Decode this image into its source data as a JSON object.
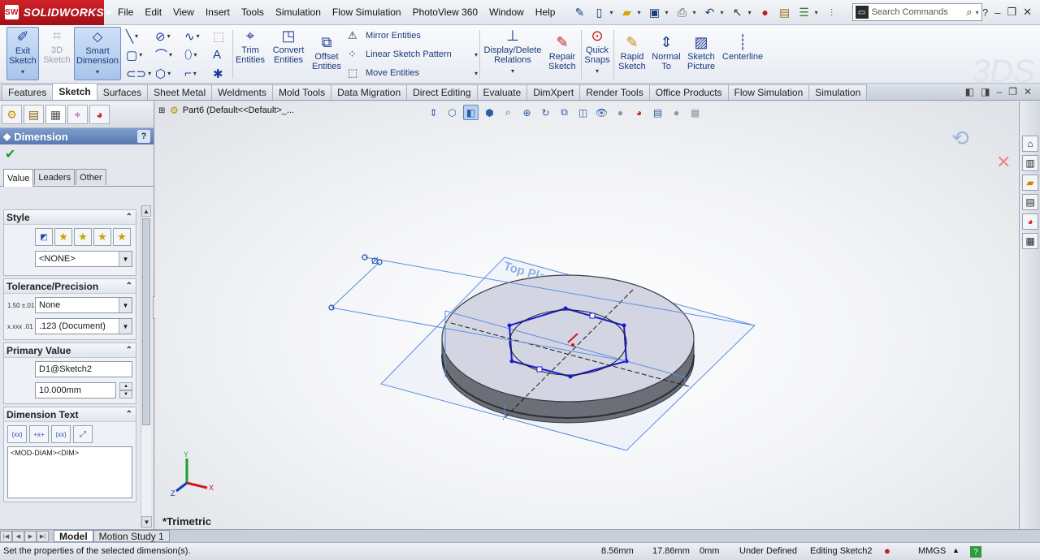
{
  "app": {
    "logo_text": "SOLIDWORKS",
    "logo_badge": "SW"
  },
  "menu": [
    "File",
    "Edit",
    "View",
    "Insert",
    "Tools",
    "Simulation",
    "Flow Simulation",
    "PhotoView 360",
    "Window",
    "Help"
  ],
  "search": {
    "placeholder": "Search Commands"
  },
  "toolbar": {
    "exit_sketch": "Exit Sketch",
    "sketch_3d": "3D Sketch",
    "smart_dimension": "Smart Dimension",
    "trim_entities": "Trim Entities",
    "convert_entities": "Convert Entities",
    "offset_entities": "Offset Entities",
    "mirror_entities": "Mirror Entities",
    "linear_sketch_pattern": "Linear Sketch Pattern",
    "move_entities": "Move Entities",
    "display_delete_relations": "Display/Delete Relations",
    "repair_sketch": "Repair Sketch",
    "quick_snaps": "Quick Snaps",
    "rapid_sketch": "Rapid Sketch",
    "normal_to": "Normal To",
    "sketch_picture": "Sketch Picture",
    "centerline": "Centerline"
  },
  "command_tabs": [
    "Features",
    "Sketch",
    "Surfaces",
    "Sheet Metal",
    "Weldments",
    "Mold Tools",
    "Data Migration",
    "Direct Editing",
    "Evaluate",
    "DimXpert",
    "Render Tools",
    "Office Products",
    "Flow Simulation",
    "Simulation"
  ],
  "active_command_tab": "Sketch",
  "property_manager": {
    "title": "Dimension",
    "help": "?",
    "tabs": [
      "Value",
      "Leaders",
      "Other"
    ],
    "style": {
      "header": "Style",
      "selected": "<NONE>"
    },
    "tolerance": {
      "header": "Tolerance/Precision",
      "tolerance_type": "None",
      "precision": ".123 (Document)",
      "tol_icon": "1.50 ±.01",
      "prec_icon": "x.xxx .01"
    },
    "primary_value": {
      "header": "Primary Value",
      "name": "D1@Sketch2",
      "value": "10.000mm"
    },
    "dimension_text": {
      "header": "Dimension Text",
      "text": "<MOD-DIAM><DIM>",
      "btn1": "(xx)",
      "btn2": "+x+",
      "btn3": "(xx)"
    }
  },
  "viewport": {
    "part_path": "Part6  (Default<<Default>_...",
    "view_label": "*Trimetric",
    "plane_label": "Top Plane",
    "dimension_value": "Ø"
  },
  "bottom_tabs": [
    "Model",
    "Motion Study 1"
  ],
  "status": {
    "message": "Set the properties of the selected dimension(s).",
    "x": "8.56mm",
    "y": "17.86mm",
    "z": "0mm",
    "state": "Under Defined",
    "mode": "Editing Sketch2",
    "units": "MMGS"
  },
  "colors": {
    "accent": "#5778b0",
    "sketch_blue": "#1a1ad0",
    "plane_blue": "#5a8fe0",
    "logo_red": "#c4161c"
  }
}
